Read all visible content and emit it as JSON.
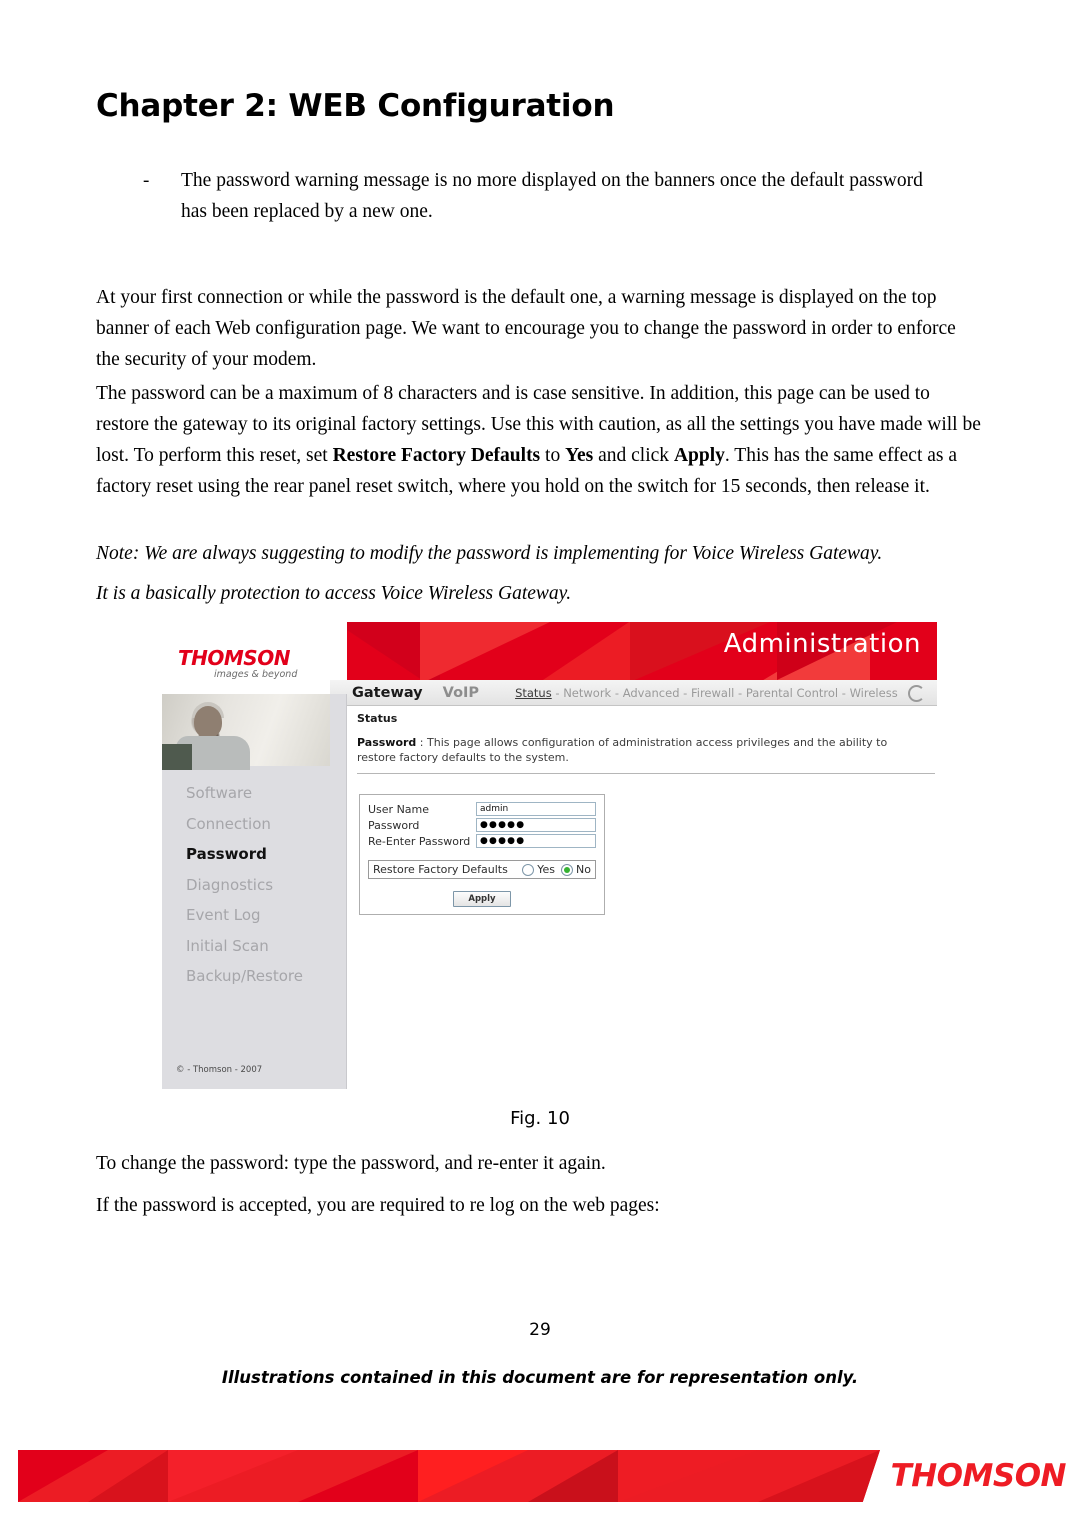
{
  "document": {
    "chapter_title": "Chapter 2: WEB Configuration",
    "bullet": {
      "marker": "-",
      "text": "The password warning message is no more displayed on the banners once the default password has been replaced by a new one."
    },
    "paragraph_1": "At your first connection or while the password is the default one, a warning message is displayed on the top banner of each Web configuration page. We want to encourage you to change the password in order to enforce the security of your modem.",
    "paragraph_2": {
      "part_1": "The password can be a maximum of 8 characters and is case sensitive. In addition, this page can be used to restore the gateway to its original factory settings. Use this with caution, as all the settings you have made will be lost. To perform this reset, set ",
      "bold_1": "Restore Factory Defaults",
      "part_2": " to ",
      "bold_2": "Yes",
      "part_3": " and click ",
      "bold_3": "Apply",
      "part_4": ". This has the same effect as a factory reset using the rear panel reset switch, where you hold on the switch for 15 seconds, then release it."
    },
    "note_line_1": "Note: We are always suggesting to modify the password is implementing for Voice Wireless Gateway.",
    "note_line_2": "It is a basically protection to access Voice Wireless Gateway.",
    "figure_caption": "Fig. 10",
    "tail_line_1": "To change the password: type the password, and re-enter it again.",
    "tail_line_2": "If the password is accepted, you are required to re log on the web pages:",
    "page_number": "29",
    "disclaimer": "Illustrations contained in this document are for representation only."
  },
  "screenshot": {
    "logo": {
      "word": "THOMSON",
      "tagline": "images & beyond"
    },
    "banner_title": "Administration",
    "nav": {
      "primary": [
        {
          "label": "Gateway",
          "active": true
        },
        {
          "label": "VoIP",
          "active": false
        }
      ],
      "secondary": [
        {
          "label": "Status",
          "active": true
        },
        {
          "label": "Network",
          "active": false
        },
        {
          "label": "Advanced",
          "active": false
        },
        {
          "label": "Firewall",
          "active": false
        },
        {
          "label": "Parental Control",
          "active": false
        },
        {
          "label": "Wireless",
          "active": false
        }
      ],
      "separator": "-",
      "refresh_icon": "refresh-icon"
    },
    "sidebar": {
      "items": [
        {
          "label": "Software",
          "active": false
        },
        {
          "label": "Connection",
          "active": false
        },
        {
          "label": "Password",
          "active": true
        },
        {
          "label": "Diagnostics",
          "active": false
        },
        {
          "label": "Event Log",
          "active": false
        },
        {
          "label": "Initial Scan",
          "active": false
        },
        {
          "label": "Backup/Restore",
          "active": false
        }
      ],
      "copyright": "© - Thomson - 2007"
    },
    "main": {
      "section_title": "Status",
      "description_label": "Password",
      "description_separator": " :  ",
      "description_text": "This page allows configuration of administration access privileges and the ability to restore factory defaults to the system."
    },
    "form": {
      "username_label": "User Name",
      "username_value": "admin",
      "password_label": "Password",
      "password_value": "●●●●●",
      "reenter_label": "Re-Enter Password",
      "reenter_value": "●●●●●",
      "restore_label": "Restore Factory Defaults",
      "restore_yes": "Yes",
      "restore_no": "No",
      "restore_selected": "No",
      "apply_label": "Apply"
    }
  },
  "footer": {
    "brand": "THOMSON",
    "brand_color": "#ee1c24"
  }
}
